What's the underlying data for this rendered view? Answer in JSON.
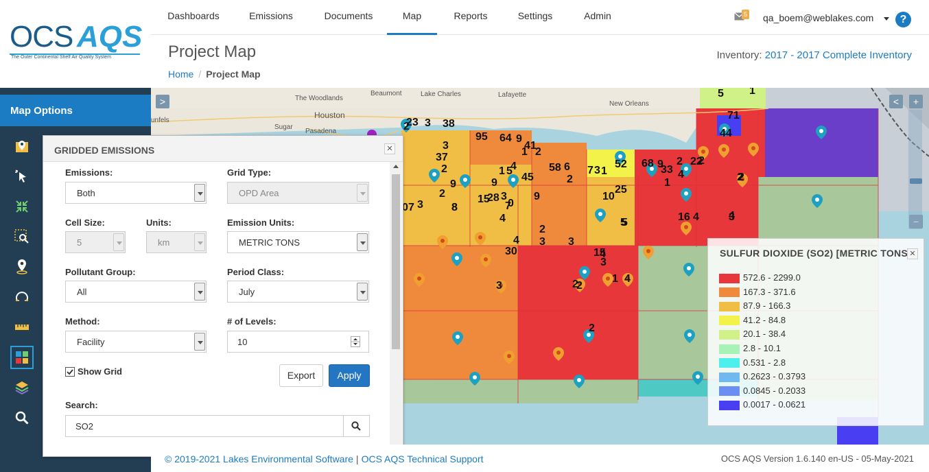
{
  "app": {
    "logo_text_1": "OCS",
    "logo_text_2": "AQS",
    "logo_tagline": "The Outer Continental Shelf Air Quality System"
  },
  "sidebar": {
    "heading": "Map Options",
    "tools": [
      {
        "icon": "map-marker-settings-icon"
      },
      {
        "icon": "cursor-select-icon"
      },
      {
        "icon": "collapse-arrows-icon"
      },
      {
        "icon": "zoom-area-icon"
      },
      {
        "icon": "location-pin-icon"
      },
      {
        "icon": "radius-search-icon"
      },
      {
        "icon": "ruler-icon"
      },
      {
        "icon": "grid-icon"
      },
      {
        "icon": "layers-icon"
      },
      {
        "icon": "magnifier-icon"
      }
    ]
  },
  "nav": {
    "items": [
      "Dashboards",
      "Emissions",
      "Documents",
      "Map",
      "Reports",
      "Settings",
      "Admin"
    ],
    "active": "Map",
    "mail_count": "5",
    "user": "qa_boem@weblakes.com",
    "help": "?"
  },
  "header": {
    "title": "Project Map",
    "breadcrumb_home": "Home",
    "breadcrumb_sep": "/",
    "breadcrumb_current": "Project Map",
    "inventory_label": "Inventory:",
    "inventory_value": "2017 - 2017 Complete Inventory"
  },
  "map": {
    "places": [
      "Beaumont",
      "Lake Charles",
      "Lafayette",
      "The Woodlands",
      "Houston",
      "New Orleans",
      "Sugar",
      "Pasadena",
      "unfels"
    ],
    "collapse_toggle": ">",
    "collapse_right": "<",
    "zoom_in": "+",
    "zoom_out": "−",
    "pin_labels": [
      "5",
      "1",
      "71",
      "2",
      "23",
      "3",
      "38",
      "44",
      "95",
      "64",
      "9",
      "41",
      "1",
      "2",
      "37",
      "2",
      "3",
      "22",
      "1",
      "5",
      "8",
      "7",
      "3",
      "0",
      "2",
      "4",
      "45",
      "58",
      "6",
      "7",
      "3",
      "1",
      "52",
      "68",
      "9",
      "33",
      "2",
      "2",
      "4",
      "2",
      "9",
      "2",
      "9",
      "15",
      "28",
      "3",
      "0",
      "10",
      "25",
      "16",
      "4",
      "3",
      "1",
      "4",
      "5",
      "3",
      "30",
      "4",
      "9",
      "7",
      "2",
      "4",
      "5",
      "3",
      "8",
      "2",
      "3",
      "4",
      "1",
      "15",
      "3",
      "2",
      "4",
      "2",
      "2"
    ]
  },
  "legend": {
    "title": "SULFUR DIOXIDE (SO2) [METRIC TONS]",
    "close": "✕",
    "rows": [
      {
        "color": "#e8373a",
        "label": "572.6 - 2299.0"
      },
      {
        "color": "#ef8a3c",
        "label": "167.3 - 371.6"
      },
      {
        "color": "#f0be44",
        "label": "87.9 - 166.3"
      },
      {
        "color": "#f2f24a",
        "label": "41.2 - 84.8"
      },
      {
        "color": "#d0f088",
        "label": "20.1 - 38.4"
      },
      {
        "color": "#a8f2b8",
        "label": "2.8 - 10.1"
      },
      {
        "color": "#4ef0ee",
        "label": "0.531 - 2.8"
      },
      {
        "color": "#6fb8f0",
        "label": "0.2623 - 0.3793"
      },
      {
        "color": "#6a8ef2",
        "label": "0.0845 - 0.2033"
      },
      {
        "color": "#4a3ef2",
        "label": "0.0017 - 0.0621"
      }
    ]
  },
  "panel": {
    "title": "GRIDDED EMISSIONS",
    "close": "✕",
    "emissions_label": "Emissions:",
    "emissions_value": "Both",
    "grid_type_label": "Grid Type:",
    "grid_type_value": "OPD Area",
    "cell_size_label": "Cell Size:",
    "cell_size_value": "5",
    "units_label": "Units:",
    "units_value": "km",
    "emission_units_label": "Emission Units:",
    "emission_units_value": "METRIC TONS",
    "pollutant_group_label": "Pollutant Group:",
    "pollutant_group_value": "All",
    "period_class_label": "Period Class:",
    "period_class_value": "July",
    "method_label": "Method:",
    "method_value": "Facility",
    "levels_label": "# of Levels:",
    "levels_value": "10",
    "show_grid_label": "Show Grid",
    "show_grid_checked": true,
    "export_label": "Export",
    "apply_label": "Apply",
    "search_label": "Search:",
    "search_value": "SO2"
  },
  "footer": {
    "copyright": "© 2019-2021 Lakes Environmental Software",
    "sep": "|",
    "support": "OCS AQS Technical Support",
    "version": "OCS AQS Version 1.6.140 en-US - 05-May-2021"
  }
}
